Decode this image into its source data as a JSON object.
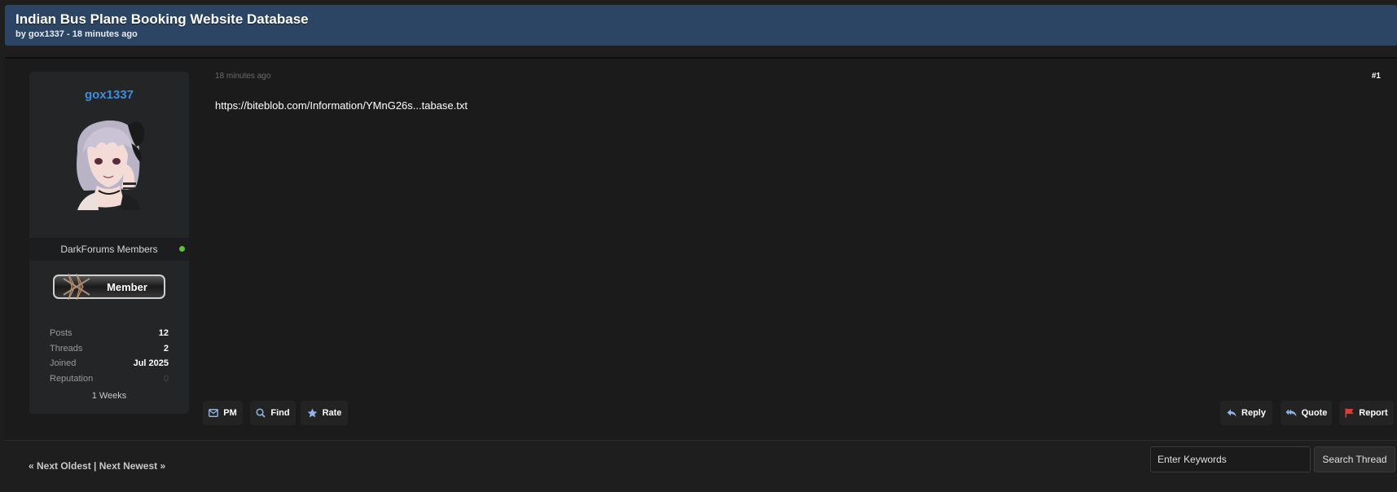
{
  "thread": {
    "title": "Indian Bus Plane Booking Website Database",
    "meta": "by gox1337 - 18 minutes ago"
  },
  "author": {
    "username": "gox1337",
    "avatar_icon": "anime-character-avatar",
    "group": "DarkForums Members",
    "online": true,
    "badge_label": "Member",
    "stats": [
      {
        "label": "Posts",
        "value": "12"
      },
      {
        "label": "Threads",
        "value": "2"
      },
      {
        "label": "Joined",
        "value": "Jul 2025"
      },
      {
        "label": "Reputation",
        "value": "0"
      }
    ],
    "tenure": "1 Weeks"
  },
  "post": {
    "date": "18 minutes ago",
    "number": "#1",
    "body": "https://biteblob.com/Information/YMnG26s...tabase.txt"
  },
  "left_actions": [
    {
      "label": "PM",
      "icon": "envelope-icon"
    },
    {
      "label": "Find",
      "icon": "search-icon"
    },
    {
      "label": "Rate",
      "icon": "star-icon"
    }
  ],
  "right_actions": [
    {
      "label": "Reply",
      "icon": "reply-icon"
    },
    {
      "label": "Quote",
      "icon": "quote-icon"
    },
    {
      "label": "Report",
      "icon": "flag-icon"
    }
  ],
  "footer": {
    "prev_label": "« Next Oldest",
    "separator": "|",
    "next_label": "Next Newest »",
    "search_placeholder": "Enter Keywords",
    "search_button": "Search Thread"
  },
  "colors": {
    "header_bg": "#2c4564",
    "username": "#3d8fdc",
    "online": "#5fbf3a",
    "report_flag": "#e23b2e"
  }
}
